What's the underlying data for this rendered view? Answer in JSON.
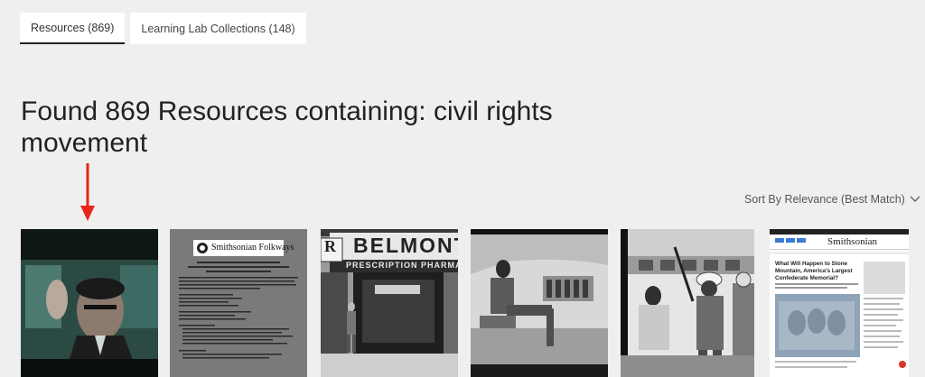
{
  "tabs": [
    {
      "label": "Resources (869)",
      "active": true
    },
    {
      "label": "Learning Lab Collections (148)",
      "active": false
    }
  ],
  "heading": "Found 869 Resources containing: civil rights movement",
  "sort_label": "Sort By Relevance (Best Match)",
  "thumbs": {
    "folkways_label": "Smithsonian Folkways",
    "belmont_sign": "BELMONT",
    "pharmacy_sign": "PRESCRIPTION PHARMAC",
    "rx_symbol": "R",
    "article_brand": "Smithsonian",
    "article_title": "What Will Happen to Stone Mountain, America's Largest Confederate Memorial?"
  },
  "colors": {
    "arrow": "#e8261c",
    "background": "#efefef"
  }
}
